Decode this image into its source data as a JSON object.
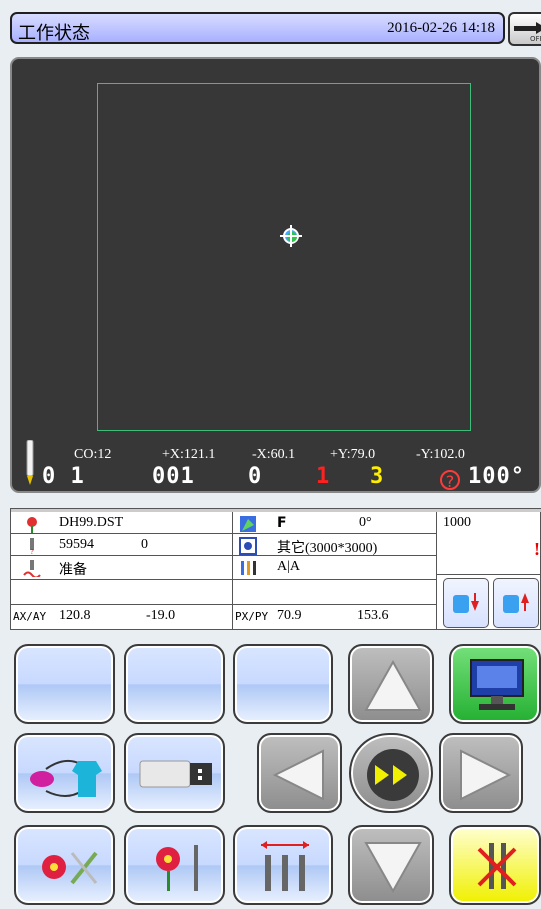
{
  "header": {
    "title": "工作状态",
    "datetime": "2016-02-26  14:18",
    "off_label": "OFF"
  },
  "display": {
    "co": "CO:12",
    "plus_x": "+X:121.1",
    "minus_x": "-X:60.1",
    "plus_y": "+Y:79.0",
    "minus_y": "-Y:102.0",
    "big1": "0 1",
    "big2": "001",
    "big3": "0",
    "big4": "1",
    "big5": "3",
    "speed": "100"
  },
  "info": {
    "file": "DH99.DST",
    "frame_label": "F",
    "angle": "0°",
    "right_top": "1000",
    "stitches": "59594",
    "stitch_count": "0",
    "frame_type": "其它(3000*3000)",
    "status": "准备",
    "color_seq": "A|A",
    "ax_label": "AX/AY",
    "ax": "120.8",
    "ay": "-19.0",
    "px_label": "PX/PY",
    "px": "70.9",
    "py": "153.6"
  },
  "colors": {
    "title_bar": "#b6bcff",
    "display_bg": "#373737",
    "frame": "#3dbd77"
  }
}
